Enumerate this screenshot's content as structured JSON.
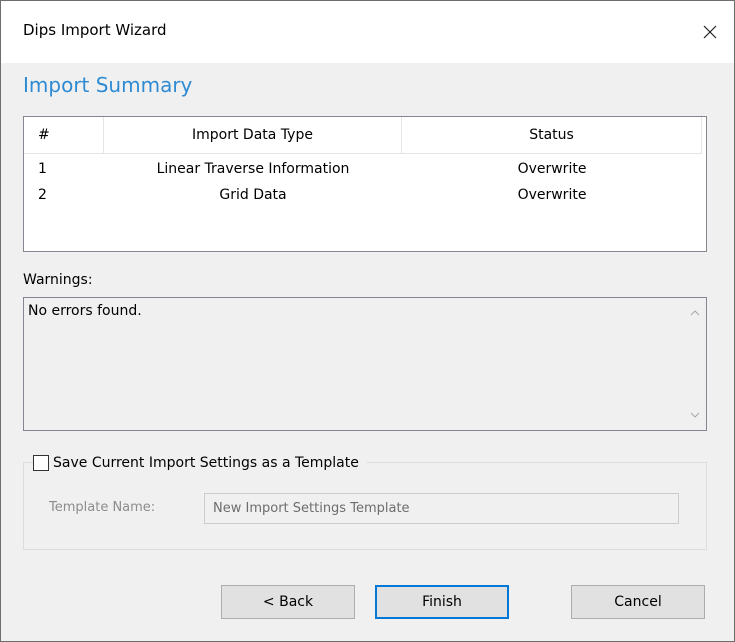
{
  "window": {
    "title": "Dips Import Wizard",
    "close_glyph": "✕"
  },
  "section_title": "Import Summary",
  "table": {
    "columns": [
      "#",
      "Import Data Type",
      "Status"
    ],
    "rows": [
      {
        "num": "1",
        "type": "Linear Traverse Information",
        "status": "Overwrite"
      },
      {
        "num": "2",
        "type": "Grid Data",
        "status": "Overwrite"
      }
    ]
  },
  "warnings": {
    "label": "Warnings:",
    "text": "No errors found."
  },
  "template": {
    "checkbox_label": "Save Current Import Settings as a Template",
    "checked": false,
    "name_label": "Template Name:",
    "name_placeholder": "New Import Settings Template"
  },
  "buttons": {
    "back": "< Back",
    "finish": "Finish",
    "cancel": "Cancel"
  },
  "colors": {
    "accent": "#2e8bd3",
    "focus": "#0078d7"
  }
}
